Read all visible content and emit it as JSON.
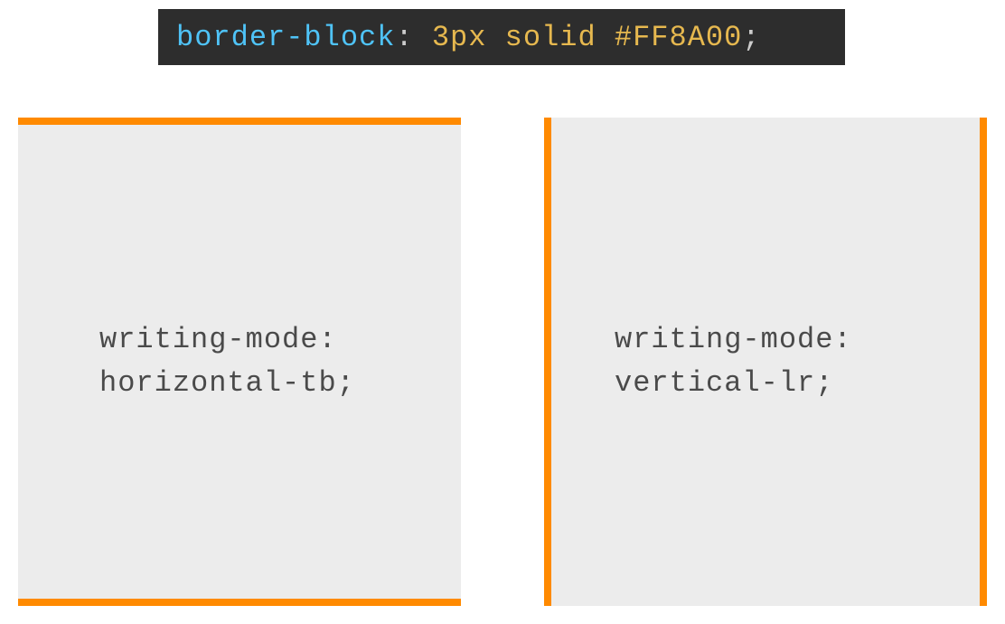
{
  "code": {
    "property": "border-block",
    "colon": ":",
    "value": "3px solid #FF8A00",
    "semicolon": ";"
  },
  "examples": {
    "left": {
      "line1": "writing-mode:",
      "line2": "horizontal-tb;"
    },
    "right": {
      "line1": "writing-mode:",
      "line2": "vertical-lr;"
    }
  },
  "accent_color": "#FF8A00"
}
